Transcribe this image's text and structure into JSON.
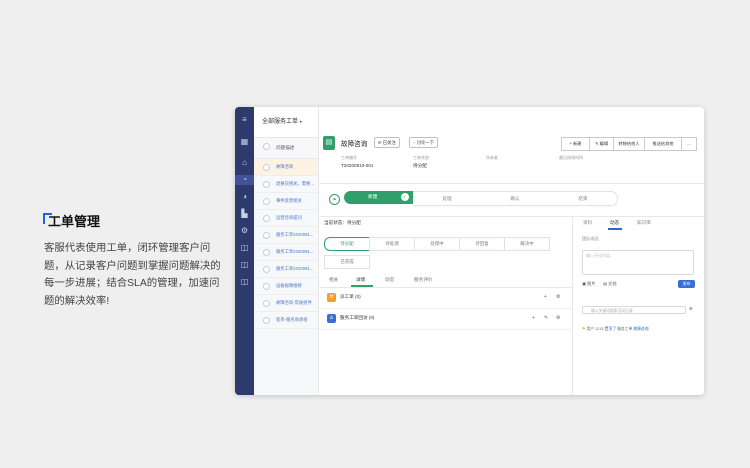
{
  "promo": {
    "title": "工单管理",
    "body": "客服代表使用工单，闭环管理客户问题，从记录客户问题到掌握问题解决的每一步进展；结合SLA的管理，加速问题的解决效率!"
  },
  "accent_color": "#2fa06a",
  "brand_color": "#2d3a6d",
  "rail_icons": [
    "menu-icon",
    "apps-icon",
    "home-icon",
    "chart-icon",
    "pie-icon",
    "stats-icon",
    "gear-icon",
    "book-icon",
    "book-icon",
    "book-icon"
  ],
  "list": {
    "view_name": "全部服务工单",
    "column_header": "问题描述",
    "rows": [
      "故障咨询",
      "退换货相关，需要...",
      "事件反馈相关",
      "运营咨询提问",
      "服务工单2020091...",
      "服务工单2020091...",
      "服务工单2020091...",
      "设备报障维修",
      "故障咨询-常规组件",
      "客单-服务商承接"
    ]
  },
  "ticket": {
    "title": "故障咨询",
    "follow_btn": "已关注",
    "discuss_btn": "讨论一下",
    "fields": [
      {
        "label": "工单编号",
        "value": "T20200910-001"
      },
      {
        "label": "工单状态",
        "value": "待分配"
      },
      {
        "label": "所有者",
        "value": ""
      },
      {
        "label": "最后修改时间",
        "value": ""
      }
    ],
    "toolbar": [
      "新建",
      "编辑",
      "转移给他人",
      "推送给其他",
      "..."
    ]
  },
  "stages": {
    "active": "新建",
    "others": [
      "处理",
      "确认",
      "结束"
    ]
  },
  "current_status": "当前状态：待分配",
  "subflow": [
    "待分配",
    "待处理",
    "处理中",
    "待回复",
    "解决中",
    "已完成"
  ],
  "tabs": [
    "相关",
    "详情",
    "动态",
    "服务评价"
  ],
  "active_tab": "详情",
  "sections": [
    {
      "title": "派工单 (0)",
      "icon": "wrench-icon",
      "color": "#f0a024"
    },
    {
      "title": "服务工单回访 (0)",
      "icon": "person-icon",
      "color": "#3a6fd8"
    }
  ],
  "right": {
    "tabs": [
      "资料",
      "动态",
      "知识库"
    ],
    "active_tab": "动态",
    "group_label": "团队成员",
    "input_placeholder": "输入评论内容...",
    "attach_image": "图片",
    "attach_file": "文档",
    "publish_btn": "发布",
    "search_placeholder": "输入关键词搜索活动记录",
    "activity_user": "用户 1215",
    "activity_action": "置顶了",
    "activity_target": "服务工单",
    "activity_tail": "故障咨询"
  }
}
